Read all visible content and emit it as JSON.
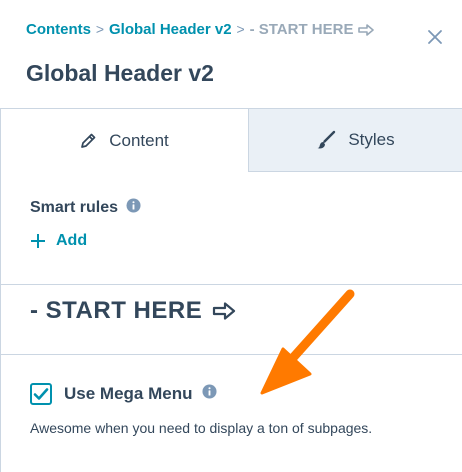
{
  "breadcrumb": {
    "items": [
      "Contents",
      "Global Header v2",
      "- START HERE"
    ],
    "separator": ">"
  },
  "header": {
    "title": "Global Header v2"
  },
  "tabs": [
    {
      "label": "Content",
      "active": true
    },
    {
      "label": "Styles",
      "active": false
    }
  ],
  "smart_rules": {
    "label": "Smart rules",
    "add_label": "Add"
  },
  "section": {
    "heading": "- START HERE"
  },
  "mega_menu": {
    "label": "Use Mega Menu",
    "checked": true,
    "help_text": "Awesome when you need to display a ton of subpages."
  },
  "colors": {
    "accent": "#0091ae",
    "text": "#33475b",
    "muted": "#99a9b8",
    "border": "#cbd6e2",
    "tab_inactive_bg": "#eaf0f6",
    "annotation": "#ff7a00"
  },
  "icons": {
    "close": "close-icon",
    "content_tab": "pencil-icon",
    "styles_tab": "brush-icon",
    "info": "info-icon",
    "add": "plus-icon",
    "heading_arrow": "outline-arrow-right-icon",
    "checkbox": "checkmark-icon"
  }
}
